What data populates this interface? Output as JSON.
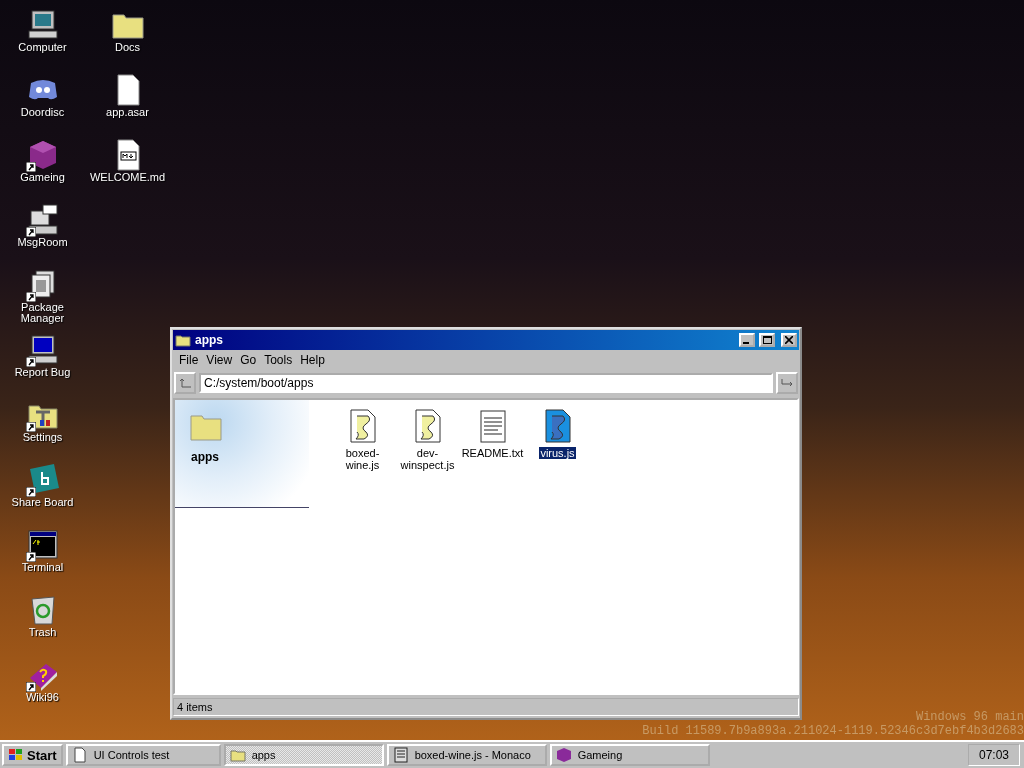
{
  "desktop": {
    "columns": [
      [
        {
          "label": "Computer",
          "kind": "computer",
          "shortcut": false
        },
        {
          "label": "Doordisc",
          "kind": "chat",
          "shortcut": false
        },
        {
          "label": "Gameing",
          "kind": "cube",
          "shortcut": true
        },
        {
          "label": "MsgRoom",
          "kind": "msgroom",
          "shortcut": true
        },
        {
          "label": "Package Manager",
          "kind": "package",
          "shortcut": true
        },
        {
          "label": "Report Bug",
          "kind": "monitor",
          "shortcut": true
        },
        {
          "label": "Settings",
          "kind": "settings",
          "shortcut": true
        },
        {
          "label": "Share Board",
          "kind": "board",
          "shortcut": true
        },
        {
          "label": "Terminal",
          "kind": "terminal",
          "shortcut": true
        },
        {
          "label": "Trash",
          "kind": "trash",
          "shortcut": false
        },
        {
          "label": "Wiki96",
          "kind": "book",
          "shortcut": true
        }
      ],
      [
        {
          "label": "Docs",
          "kind": "folder",
          "shortcut": false
        },
        {
          "label": "app.asar",
          "kind": "file",
          "shortcut": false
        },
        {
          "label": "WELCOME.md",
          "kind": "markdown",
          "shortcut": false
        }
      ]
    ],
    "build_lines": [
      "Windows 96 main",
      "Build 11589.7b9a893a.211024-1119.52346c3d7ebf4b3d2683"
    ]
  },
  "window": {
    "title": "apps",
    "menu": [
      "File",
      "View",
      "Go",
      "Tools",
      "Help"
    ],
    "address": "C:/system/boot/apps",
    "sidebar_title": "apps",
    "files": [
      {
        "name": "boxed-wine.js",
        "kind": "script",
        "selected": false
      },
      {
        "name": "dev-winspect.js",
        "kind": "script",
        "selected": false
      },
      {
        "name": "README.txt",
        "kind": "text",
        "selected": false
      },
      {
        "name": "virus.js",
        "kind": "script",
        "selected": true
      }
    ],
    "status": "4 items"
  },
  "taskbar": {
    "start": "Start",
    "tasks": [
      {
        "label": "UI Controls test",
        "kind": "page",
        "selected": false
      },
      {
        "label": "apps",
        "kind": "folder",
        "selected": true
      },
      {
        "label": "boxed-wine.js - Monaco",
        "kind": "editor",
        "selected": false
      },
      {
        "label": "Gameing",
        "kind": "cube",
        "selected": false
      }
    ],
    "clock": "07:03"
  }
}
